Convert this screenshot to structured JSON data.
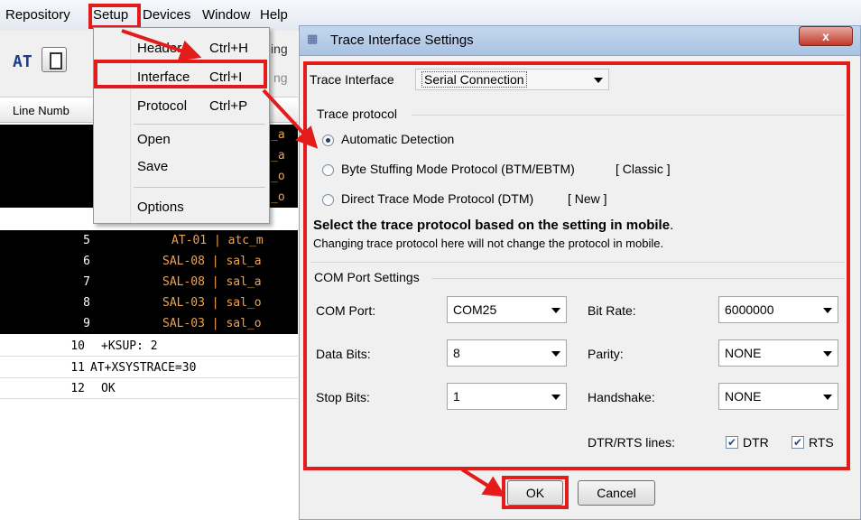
{
  "menubar": {
    "items": [
      "Repository",
      "Setup",
      "Devices",
      "Window",
      "Help"
    ]
  },
  "toolbar": {
    "at_label": "AT"
  },
  "table": {
    "column_header": "Line Numb",
    "dark_rows": [
      {
        "num": "",
        "text": "_a"
      },
      {
        "num": "",
        "text": "_a"
      },
      {
        "num": "",
        "text": "_o"
      },
      {
        "num": "",
        "text": "_o"
      },
      {
        "num": "5",
        "text": "AT-01 | atc_m"
      },
      {
        "num": "6",
        "text": "SAL-08 | sal_a"
      },
      {
        "num": "7",
        "text": "SAL-08 | sal_a"
      },
      {
        "num": "8",
        "text": "SAL-03 | sal_o"
      },
      {
        "num": "9",
        "text": "SAL-03 | sal_o"
      }
    ],
    "light_rows": [
      {
        "num": "10",
        "text": "+KSUP: 2"
      },
      {
        "num": "11",
        "text": "AT+XSYSTRACE=30"
      },
      {
        "num": "12",
        "text": "OK"
      }
    ]
  },
  "setup_menu": {
    "header": {
      "label": "Header",
      "shortcut": "Ctrl+H"
    },
    "interface": {
      "label": "Interface",
      "shortcut": "Ctrl+I"
    },
    "protocol": {
      "label": "Protocol",
      "shortcut": "Ctrl+P"
    },
    "open": "Open",
    "save": "Save",
    "options": "Options",
    "peek1": "ing",
    "peek2": "ng"
  },
  "dialog": {
    "title": "Trace Interface Settings",
    "close_label": "x",
    "trace_interface_label": "Trace Interface",
    "trace_interface_value": "Serial Connection",
    "trace_protocol_group": "Trace protocol",
    "radios": [
      {
        "label": "Automatic Detection",
        "checked": true
      },
      {
        "label": "Byte Stuffing Mode Protocol (BTM/EBTM)",
        "tag": "[ Classic ]",
        "checked": false
      },
      {
        "label": "Direct Trace Mode Protocol (DTM)",
        "tag": "[ New ]",
        "checked": false
      }
    ],
    "note_bold": "Select the trace protocol based on the setting in mobile",
    "note_bold_suffix": ".",
    "note": "Changing trace protocol here will not change the protocol in mobile.",
    "com_group": "COM Port Settings",
    "com_port_label": "COM Port:",
    "com_port_value": "COM25",
    "bit_rate_label": "Bit Rate:",
    "bit_rate_value": "6000000",
    "data_bits_label": "Data Bits:",
    "data_bits_value": "8",
    "parity_label": "Parity:",
    "parity_value": "NONE",
    "stop_bits_label": "Stop Bits:",
    "stop_bits_value": "1",
    "handshake_label": "Handshake:",
    "handshake_value": "NONE",
    "dtr_rts_label": "DTR/RTS lines:",
    "dtr_label": "DTR",
    "rts_label": "RTS",
    "dtr_checked": true,
    "rts_checked": true,
    "ok_label": "OK",
    "cancel_label": "Cancel"
  },
  "colors": {
    "highlight_red": "#e31b1b",
    "row_text_orange": "#f2a24c"
  }
}
